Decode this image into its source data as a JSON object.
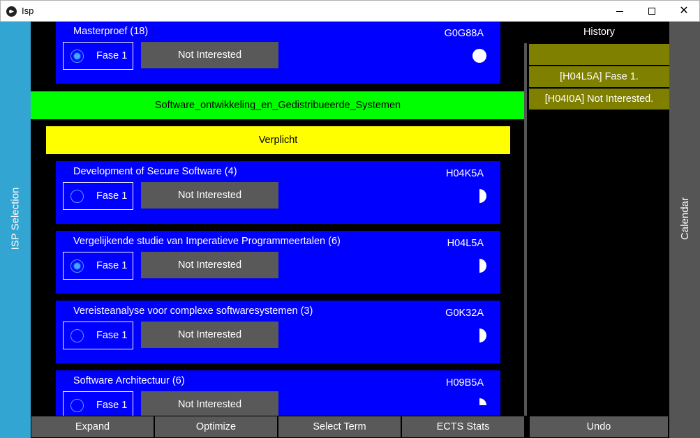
{
  "window": {
    "title": "Isp"
  },
  "sidebar_left": {
    "label": "ISP Selection"
  },
  "sidebar_right": {
    "label": "Calendar"
  },
  "main": {
    "section_band": "Software_ontwikkeling_en_Gedistribueerde_Systemen",
    "category_band": "Verplicht",
    "courses": [
      {
        "name": "Masterproef (18)",
        "code": "G0G88A",
        "fase": "Fase 1",
        "fase_selected": true,
        "button": "Not Interested",
        "progress": 1.0
      },
      {
        "name": "Development of Secure Software (4)",
        "code": "H04K5A",
        "fase": "Fase 1",
        "fase_selected": false,
        "button": "Not Interested",
        "progress": 0.5
      },
      {
        "name": "Vergelijkende studie van Imperatieve Programmeertalen (6)",
        "code": "H04L5A",
        "fase": "Fase 1",
        "fase_selected": true,
        "button": "Not Interested",
        "progress": 0.5
      },
      {
        "name": "Vereisteanalyse voor complexe softwaresystemen (3)",
        "code": "G0K32A",
        "fase": "Fase 1",
        "fase_selected": false,
        "button": "Not Interested",
        "progress": 0.5
      },
      {
        "name": "Software Architectuur (6)",
        "code": "H09B5A",
        "fase": "Fase 1",
        "fase_selected": false,
        "button": "Not Interested",
        "progress": 0.25
      }
    ]
  },
  "history": {
    "title": "History",
    "items": [
      "",
      "[H04L5A] Fase 1.",
      "[H04I0A] Not Interested."
    ]
  },
  "toolbar": {
    "expand": "Expand",
    "optimize": "Optimize",
    "select_term": "Select Term",
    "ects_stats": "ECTS Stats",
    "undo": "Undo"
  },
  "colors": {
    "course_bg": "#0000ff",
    "section_band": "#00ff00",
    "category_band": "#ffff00",
    "history_item": "#808000",
    "left_tab": "#33a5d3",
    "button": "#595959"
  }
}
